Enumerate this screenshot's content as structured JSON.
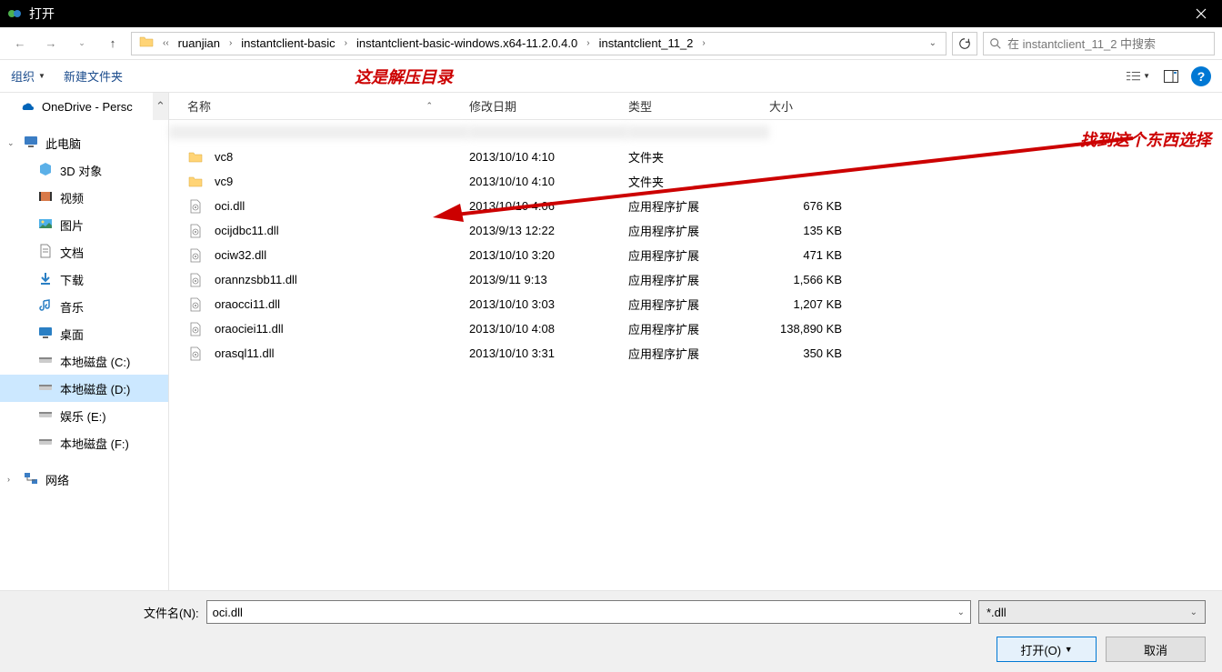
{
  "window": {
    "title": "打开"
  },
  "breadcrumb": [
    "ruanjian",
    "instantclient-basic",
    "instantclient-basic-windows.x64-11.2.0.4.0",
    "instantclient_11_2"
  ],
  "search": {
    "placeholder": "在 instantclient_11_2 中搜索"
  },
  "toolbar": {
    "organize": "组织",
    "new_folder": "新建文件夹"
  },
  "annotations": {
    "extract_dir": "这是解压目录",
    "find_select": "找到这个东西选择"
  },
  "columns": {
    "name": "名称",
    "date": "修改日期",
    "type": "类型",
    "size": "大小"
  },
  "sidebar": {
    "onedrive": "OneDrive - Persc",
    "this_pc": "此电脑",
    "objects_3d": "3D 对象",
    "videos": "视频",
    "pictures": "图片",
    "documents": "文档",
    "downloads": "下载",
    "music": "音乐",
    "desktop": "桌面",
    "disk_c": "本地磁盘 (C:)",
    "disk_d": "本地磁盘 (D:)",
    "disk_e": "娱乐 (E:)",
    "disk_f": "本地磁盘 (F:)",
    "network": "网络"
  },
  "files": [
    {
      "name": "vc8",
      "date": "2013/10/10 4:10",
      "type": "文件夹",
      "size": "",
      "icon": "folder"
    },
    {
      "name": "vc9",
      "date": "2013/10/10 4:10",
      "type": "文件夹",
      "size": "",
      "icon": "folder"
    },
    {
      "name": "oci.dll",
      "date": "2013/10/10 4:06",
      "type": "应用程序扩展",
      "size": "676 KB",
      "icon": "dll"
    },
    {
      "name": "ocijdbc11.dll",
      "date": "2013/9/13 12:22",
      "type": "应用程序扩展",
      "size": "135 KB",
      "icon": "dll"
    },
    {
      "name": "ociw32.dll",
      "date": "2013/10/10 3:20",
      "type": "应用程序扩展",
      "size": "471 KB",
      "icon": "dll"
    },
    {
      "name": "orannzsbb11.dll",
      "date": "2013/9/11 9:13",
      "type": "应用程序扩展",
      "size": "1,566 KB",
      "icon": "dll"
    },
    {
      "name": "oraocci11.dll",
      "date": "2013/10/10 3:03",
      "type": "应用程序扩展",
      "size": "1,207 KB",
      "icon": "dll"
    },
    {
      "name": "oraociei11.dll",
      "date": "2013/10/10 4:08",
      "type": "应用程序扩展",
      "size": "138,890 KB",
      "icon": "dll"
    },
    {
      "name": "orasql11.dll",
      "date": "2013/10/10 3:31",
      "type": "应用程序扩展",
      "size": "350 KB",
      "icon": "dll"
    }
  ],
  "bottom": {
    "filename_label": "文件名(N):",
    "filename_value": "oci.dll",
    "filter": "*.dll",
    "open": "打开(O)",
    "cancel": "取消"
  }
}
